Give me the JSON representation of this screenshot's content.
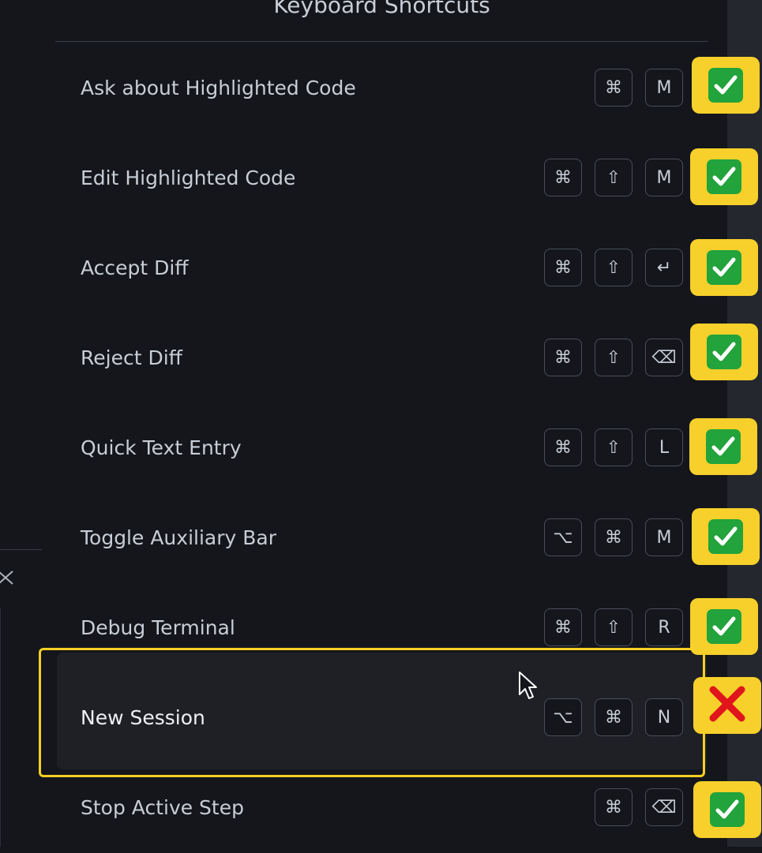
{
  "header": {
    "title": "Keyboard Shortcuts"
  },
  "shortcuts": [
    {
      "label": "Ask about Highlighted Code",
      "keys": [
        "⌘",
        "M"
      ],
      "status": "check"
    },
    {
      "label": "Edit Highlighted Code",
      "keys": [
        "⌘",
        "⇧",
        "M"
      ],
      "status": "check"
    },
    {
      "label": "Accept Diff",
      "keys": [
        "⌘",
        "⇧",
        "↵"
      ],
      "status": "check"
    },
    {
      "label": "Reject Diff",
      "keys": [
        "⌘",
        "⇧",
        "⌫"
      ],
      "status": "check"
    },
    {
      "label": "Quick Text Entry",
      "keys": [
        "⌘",
        "⇧",
        "L"
      ],
      "status": "check"
    },
    {
      "label": "Toggle Auxiliary Bar",
      "keys": [
        "⌥",
        "⌘",
        "M"
      ],
      "status": "check"
    },
    {
      "label": "Debug Terminal",
      "keys": [
        "⌘",
        "⇧",
        "R"
      ],
      "status": "check"
    },
    {
      "label": "New Session",
      "keys": [
        "⌥",
        "⌘",
        "N"
      ],
      "status": "cross",
      "highlighted": true
    },
    {
      "label": "Stop Active Step",
      "keys": [
        "⌘",
        "⌫"
      ],
      "status": "check"
    }
  ],
  "colors": {
    "background": "#14161b",
    "highlight_frame": "#f6cf23",
    "badge": "#f7d02b",
    "check": "#22a33b",
    "cross": "#e0161c"
  }
}
